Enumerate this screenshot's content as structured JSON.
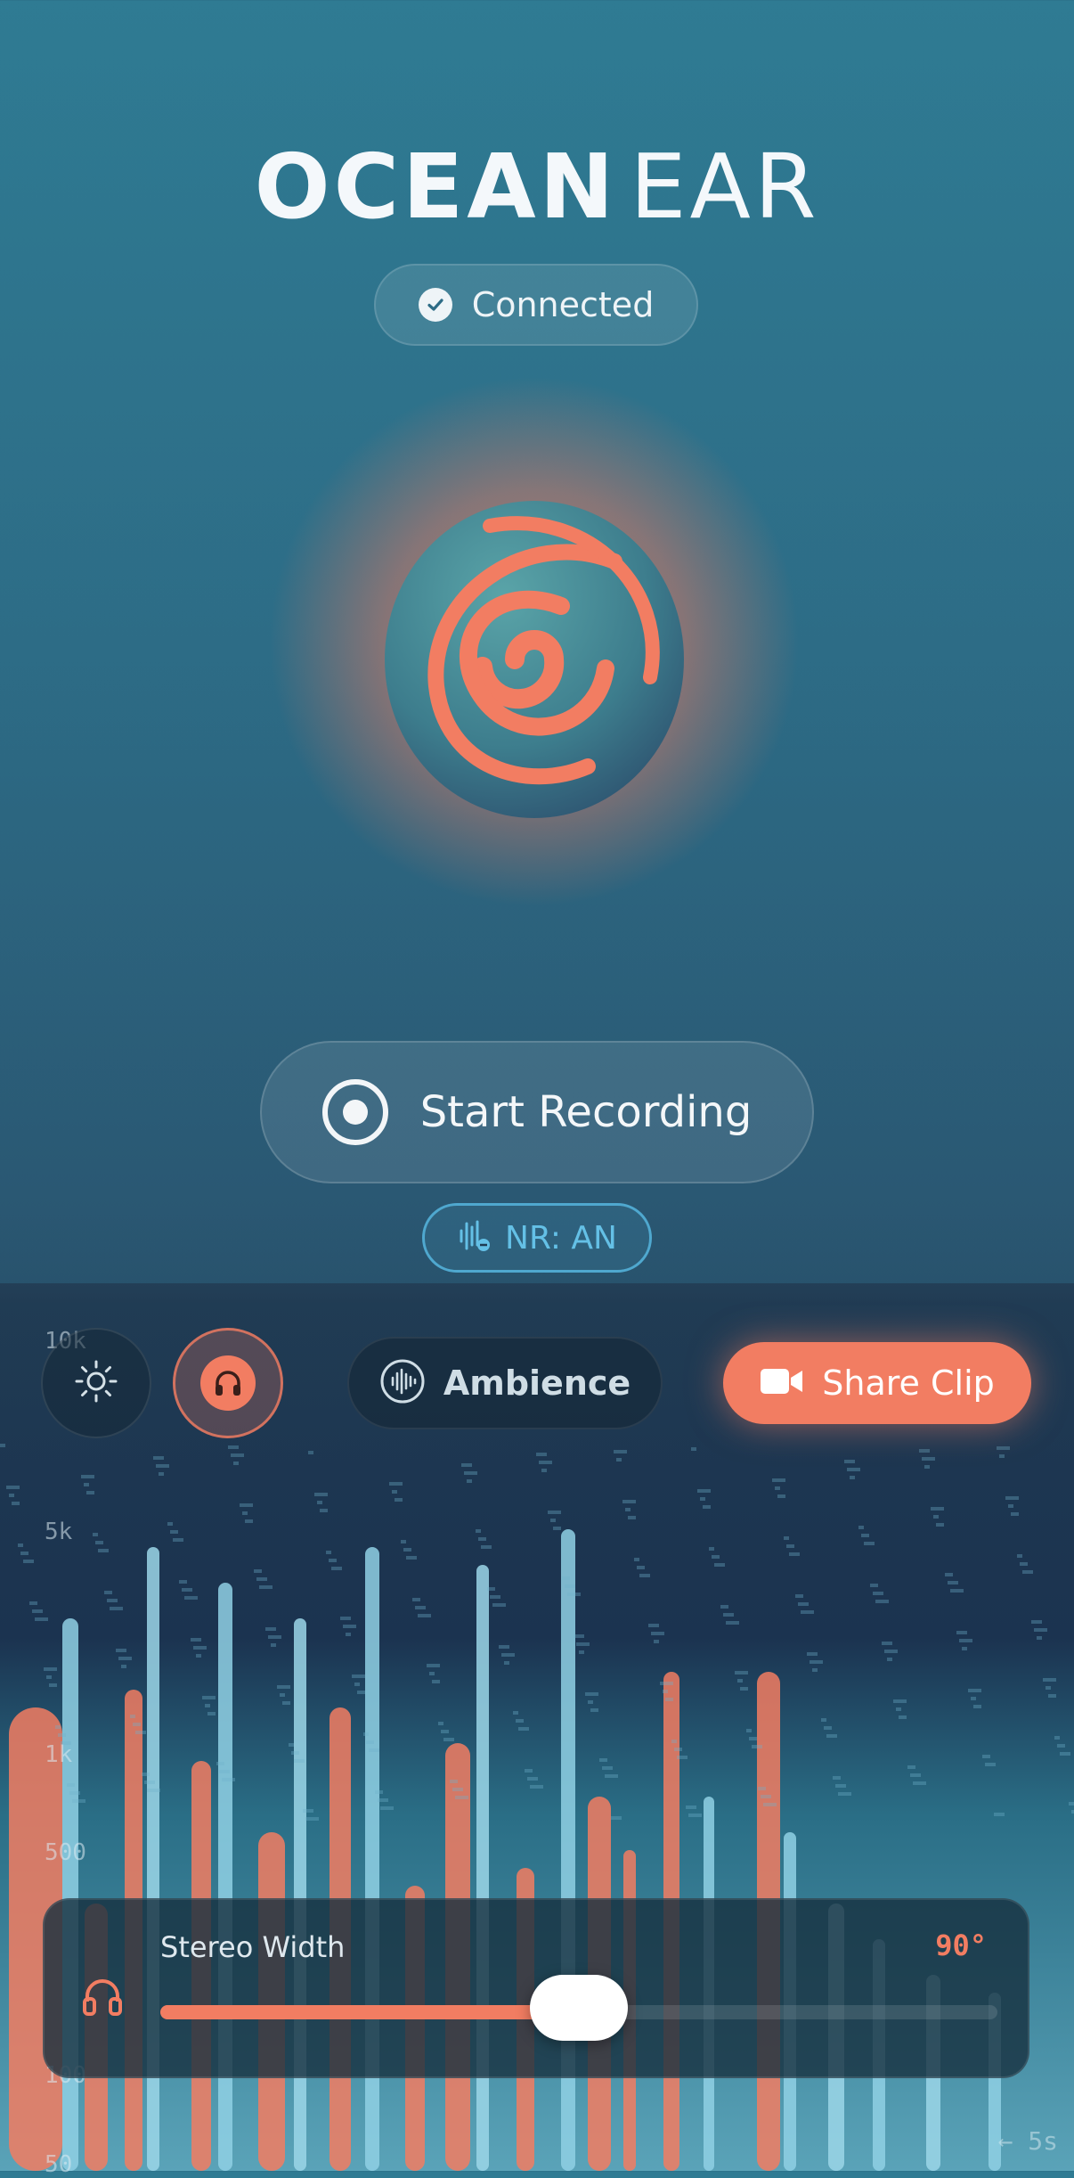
{
  "app": {
    "title_bold": "OCEAN",
    "title_light": "EAR",
    "status": "Connected"
  },
  "record": {
    "label": "Start Recording"
  },
  "nr_chip": {
    "label": "NR: AN"
  },
  "controls": {
    "brightness_icon": "sun-icon",
    "monitor_icon": "headphones-icon",
    "ambience_label": "Ambience",
    "share_label": "Share Clip"
  },
  "spectrogram": {
    "freq_labels": [
      "10k",
      "5k",
      "1k",
      "500",
      "100",
      "50"
    ],
    "time_label": "← 5s"
  },
  "stereo_width": {
    "label": "Stereo Width",
    "value": "90°",
    "fraction": 0.5
  },
  "colors": {
    "accent": "#f27d62",
    "info": "#64c0e6",
    "bg_top": "#2f7b93",
    "bg_bottom": "#1c3046"
  }
}
